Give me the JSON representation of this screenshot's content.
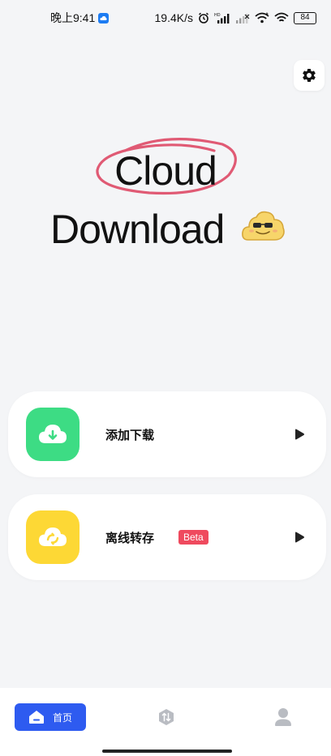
{
  "status_bar": {
    "time": "晚上9:41",
    "network_speed": "19.4K/s",
    "battery_level": "84",
    "icons": [
      "cloud-notification-icon",
      "alarm-icon",
      "hd-signal-icon",
      "signal-icon",
      "wifi-icon",
      "hotspot-icon",
      "battery-icon"
    ]
  },
  "header": {
    "settings_icon": "gear-icon"
  },
  "hero": {
    "line1": "Cloud",
    "line2": "Download",
    "ellipse_color": "#e05a74",
    "emoji": "cool-cloud-emoji"
  },
  "actions": [
    {
      "label": "添加下载",
      "icon": "cloud-download-icon",
      "icon_bg": "#3ddc84",
      "arrow_icon": "play-arrow-icon"
    },
    {
      "label": "离线转存",
      "badge": "Beta",
      "icon": "cloud-sync-icon",
      "icon_bg": "#fdd835",
      "arrow_icon": "play-arrow-icon"
    }
  ],
  "bottom_nav": {
    "items": [
      {
        "label": "首页",
        "icon": "home-icon",
        "active": true
      },
      {
        "icon": "transfer-icon",
        "active": false
      },
      {
        "icon": "profile-icon",
        "active": false
      }
    ],
    "accent": "#2e5bf0"
  }
}
